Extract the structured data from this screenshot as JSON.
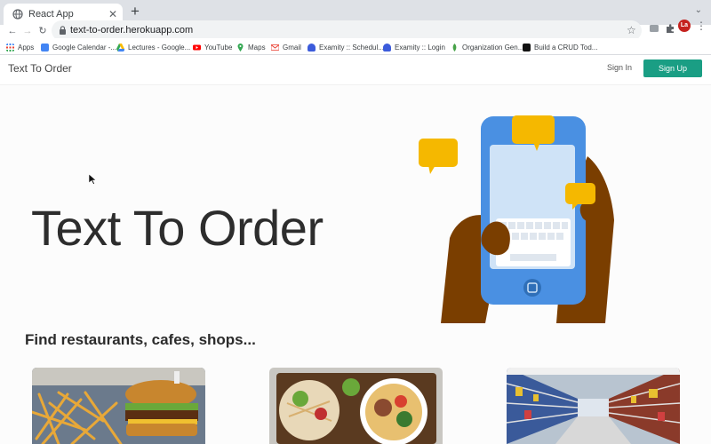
{
  "browser": {
    "tab_title": "React App",
    "url": "text-to-order.herokuapp.com",
    "profile_initials": "La"
  },
  "bookmarks": [
    {
      "label": "Apps",
      "icon": "apps-grid-icon"
    },
    {
      "label": "Google Calendar -...",
      "icon": "calendar-icon"
    },
    {
      "label": "Lectures - Google...",
      "icon": "drive-icon"
    },
    {
      "label": "YouTube",
      "icon": "youtube-icon"
    },
    {
      "label": "Maps",
      "icon": "maps-icon"
    },
    {
      "label": "Gmail",
      "icon": "gmail-icon"
    },
    {
      "label": "Examity :: Schedul...",
      "icon": "lock-icon"
    },
    {
      "label": "Examity :: Login",
      "icon": "lock-icon"
    },
    {
      "label": "Organization Gen...",
      "icon": "leaf-icon"
    },
    {
      "label": "Build a CRUD Tod...",
      "icon": "dev-icon"
    }
  ],
  "navbar": {
    "brand": "Text To Order",
    "sign_in": "Sign In",
    "sign_up": "Sign Up"
  },
  "hero": {
    "title": "Text To Order"
  },
  "section": {
    "title": "Find restaurants, cafes, shops..."
  },
  "colors": {
    "accent": "#1a9e84",
    "phone": "#4a90e2",
    "bubble": "#f5b800"
  }
}
